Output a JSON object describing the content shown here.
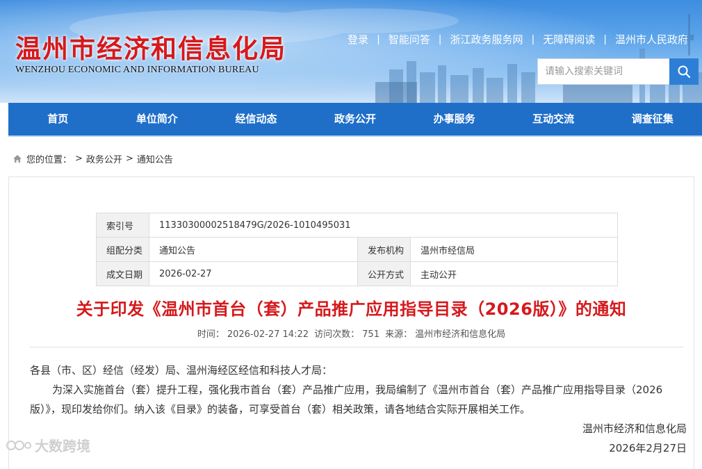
{
  "header": {
    "logo_cn": "温州市经济和信息化局",
    "logo_en": "WENZHOU ECONOMIC AND INFORMATION BUREAU",
    "top_links": [
      "登录",
      "智能问答",
      "浙江政务服务网",
      "无障碍阅读",
      "温州市人民政府"
    ],
    "separator": "|",
    "search_placeholder": "请输入搜索关键词",
    "search_icon": "magnifier-icon"
  },
  "nav": [
    "首页",
    "单位简介",
    "经信动态",
    "政务公开",
    "办事服务",
    "互动交流",
    "调查征集"
  ],
  "breadcrumb": {
    "label": "您的位置：",
    "items": [
      "政务公开",
      "通知公告"
    ],
    "sep": ">"
  },
  "meta": {
    "index_label": "索引号",
    "index_value": "11330300002518479G/2026-1010495031",
    "category_label": "组配分类",
    "category_value": "通知公告",
    "publisher_label": "发布机构",
    "publisher_value": "温州市经信局",
    "date_label": "成文日期",
    "date_value": "2026-02-27",
    "open_label": "公开方式",
    "open_value": "主动公开"
  },
  "article": {
    "title": "关于印发《温州市首台（套）产品推广应用指导目录（2026版）》的通知",
    "time_label": "时间：",
    "time_value": "2026-02-27 14:22",
    "views_label": "访问次数：",
    "views_value": "751",
    "source_label": "来源：",
    "source_value": "温州市经济和信息化局",
    "salutation": "各县（市、区）经信（经发）局、温州海经区经信和科技人才局：",
    "paragraph": "为深入实施首台（套）提升工程，强化我市首台（套）产品推广应用，我局编制了《温州市首台（套）产品推广应用指导目录（2026版）》，现印发给你们。纳入该《目录》的装备，可享受首台（套）相关政策，请各地结合实际开展相关工作。",
    "signature": "温州市经济和信息化局",
    "sign_date": "2026年2月27日"
  },
  "watermark": "大数跨境",
  "colors": {
    "nav_bg": "#1f6fc9",
    "title_red": "#d5191c",
    "search_btn": "#2d7fd6"
  }
}
